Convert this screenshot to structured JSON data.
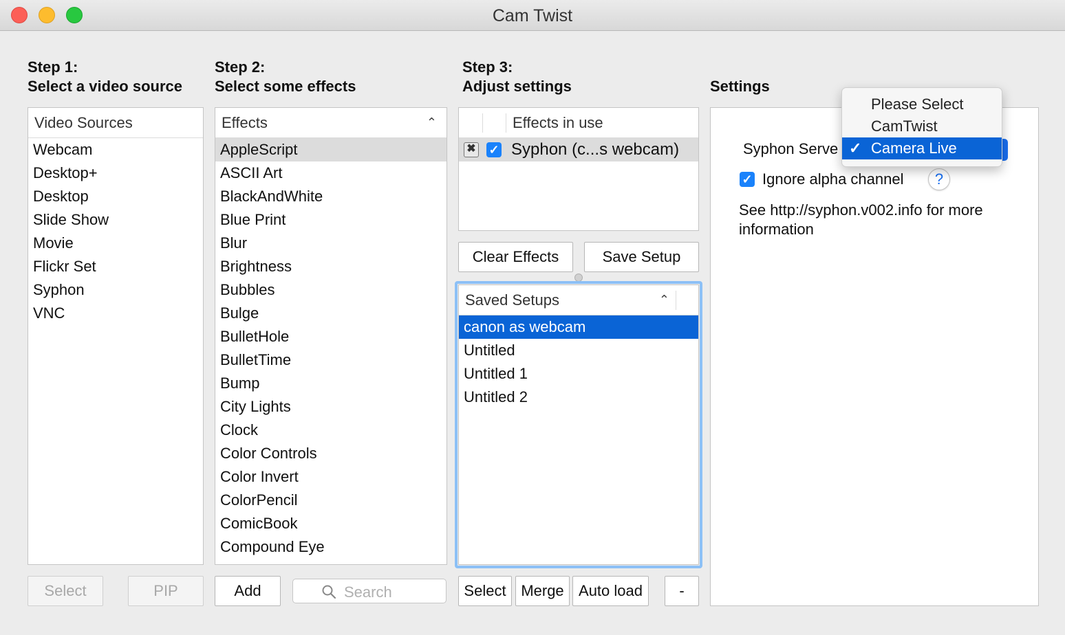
{
  "window": {
    "title": "Cam Twist"
  },
  "steps": {
    "step1": {
      "num": "Step 1:",
      "desc": "Select a video source"
    },
    "step2": {
      "num": "Step 2:",
      "desc": "Select some effects"
    },
    "step3": {
      "num": "Step 3:",
      "desc": "Adjust settings"
    },
    "settings": "Settings"
  },
  "video_sources": {
    "header": "Video Sources",
    "items": [
      "Webcam",
      "Desktop+",
      "Desktop",
      "Slide Show",
      "Movie",
      "Flickr Set",
      "Syphon",
      "VNC"
    ],
    "select_button": "Select",
    "pip_button": "PIP"
  },
  "effects": {
    "header": "Effects",
    "selected": "AppleScript",
    "items": [
      "AppleScript",
      "ASCII Art",
      "BlackAndWhite",
      "Blue Print",
      "Blur",
      "Brightness",
      "Bubbles",
      "Bulge",
      "BulletHole",
      "BulletTime",
      "Bump",
      "City Lights",
      "Clock",
      "Color Controls",
      "Color Invert",
      "ColorPencil",
      "ComicBook",
      "Compound Eye"
    ],
    "add_button": "Add",
    "search_placeholder": "Search"
  },
  "effects_in_use": {
    "header": "Effects in use",
    "items": [
      {
        "label": "Syphon (c...s webcam)",
        "enabled": true
      }
    ]
  },
  "setup_buttons": {
    "clear": "Clear Effects",
    "save": "Save Setup"
  },
  "saved_setups": {
    "header": "Saved Setups",
    "selected": "canon as webcam",
    "items": [
      "canon as webcam",
      "Untitled",
      "Untitled 1",
      "Untitled 2"
    ],
    "select_button": "Select",
    "merge_button": "Merge",
    "autoload_button": "Auto load",
    "remove_button": "-"
  },
  "settings_panel": {
    "syphon_label": "Syphon Serve",
    "ignore_alpha_label": "Ignore alpha channel",
    "ignore_alpha_checked": true,
    "help": "?",
    "info_line1": "See http://syphon.v002.info for more",
    "info_line2": "information"
  },
  "syphon_menu": {
    "options": [
      "Please Select",
      "CamTwist",
      "Camera Live"
    ],
    "selected": "Camera Live",
    "checkmark": "✓"
  },
  "colors": {
    "accent": "#0a64d6",
    "checkbox": "#1a82fb",
    "focus_ring": "#8cc0f6"
  }
}
